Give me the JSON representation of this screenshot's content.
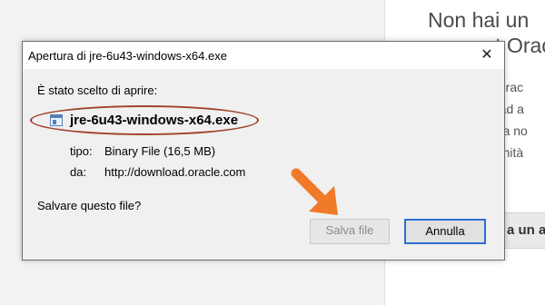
{
  "background": {
    "heading_lines": [
      "Non hai un",
      "account Oracle"
    ],
    "partial_lines": [
      "t Orac",
      "e ad a",
      "nea no",
      "nunità"
    ],
    "button_label": "a un a"
  },
  "dialog": {
    "title": "Apertura di jre-6u43-windows-x64.exe",
    "prompt": "È stato scelto di aprire:",
    "file_name": "jre-6u43-windows-x64.exe",
    "type_label": "tipo:",
    "type_value": "Binary File (16,5 MB)",
    "from_label": "da:",
    "from_value": "http://download.oracle.com",
    "question": "Salvare questo file?",
    "save_button": "Salva file",
    "cancel_button": "Annulla",
    "close_icon": "close-icon"
  },
  "colors": {
    "highlight": "#a0432a",
    "arrow": "#f07a2a",
    "focus_border": "#2c6fd1"
  }
}
